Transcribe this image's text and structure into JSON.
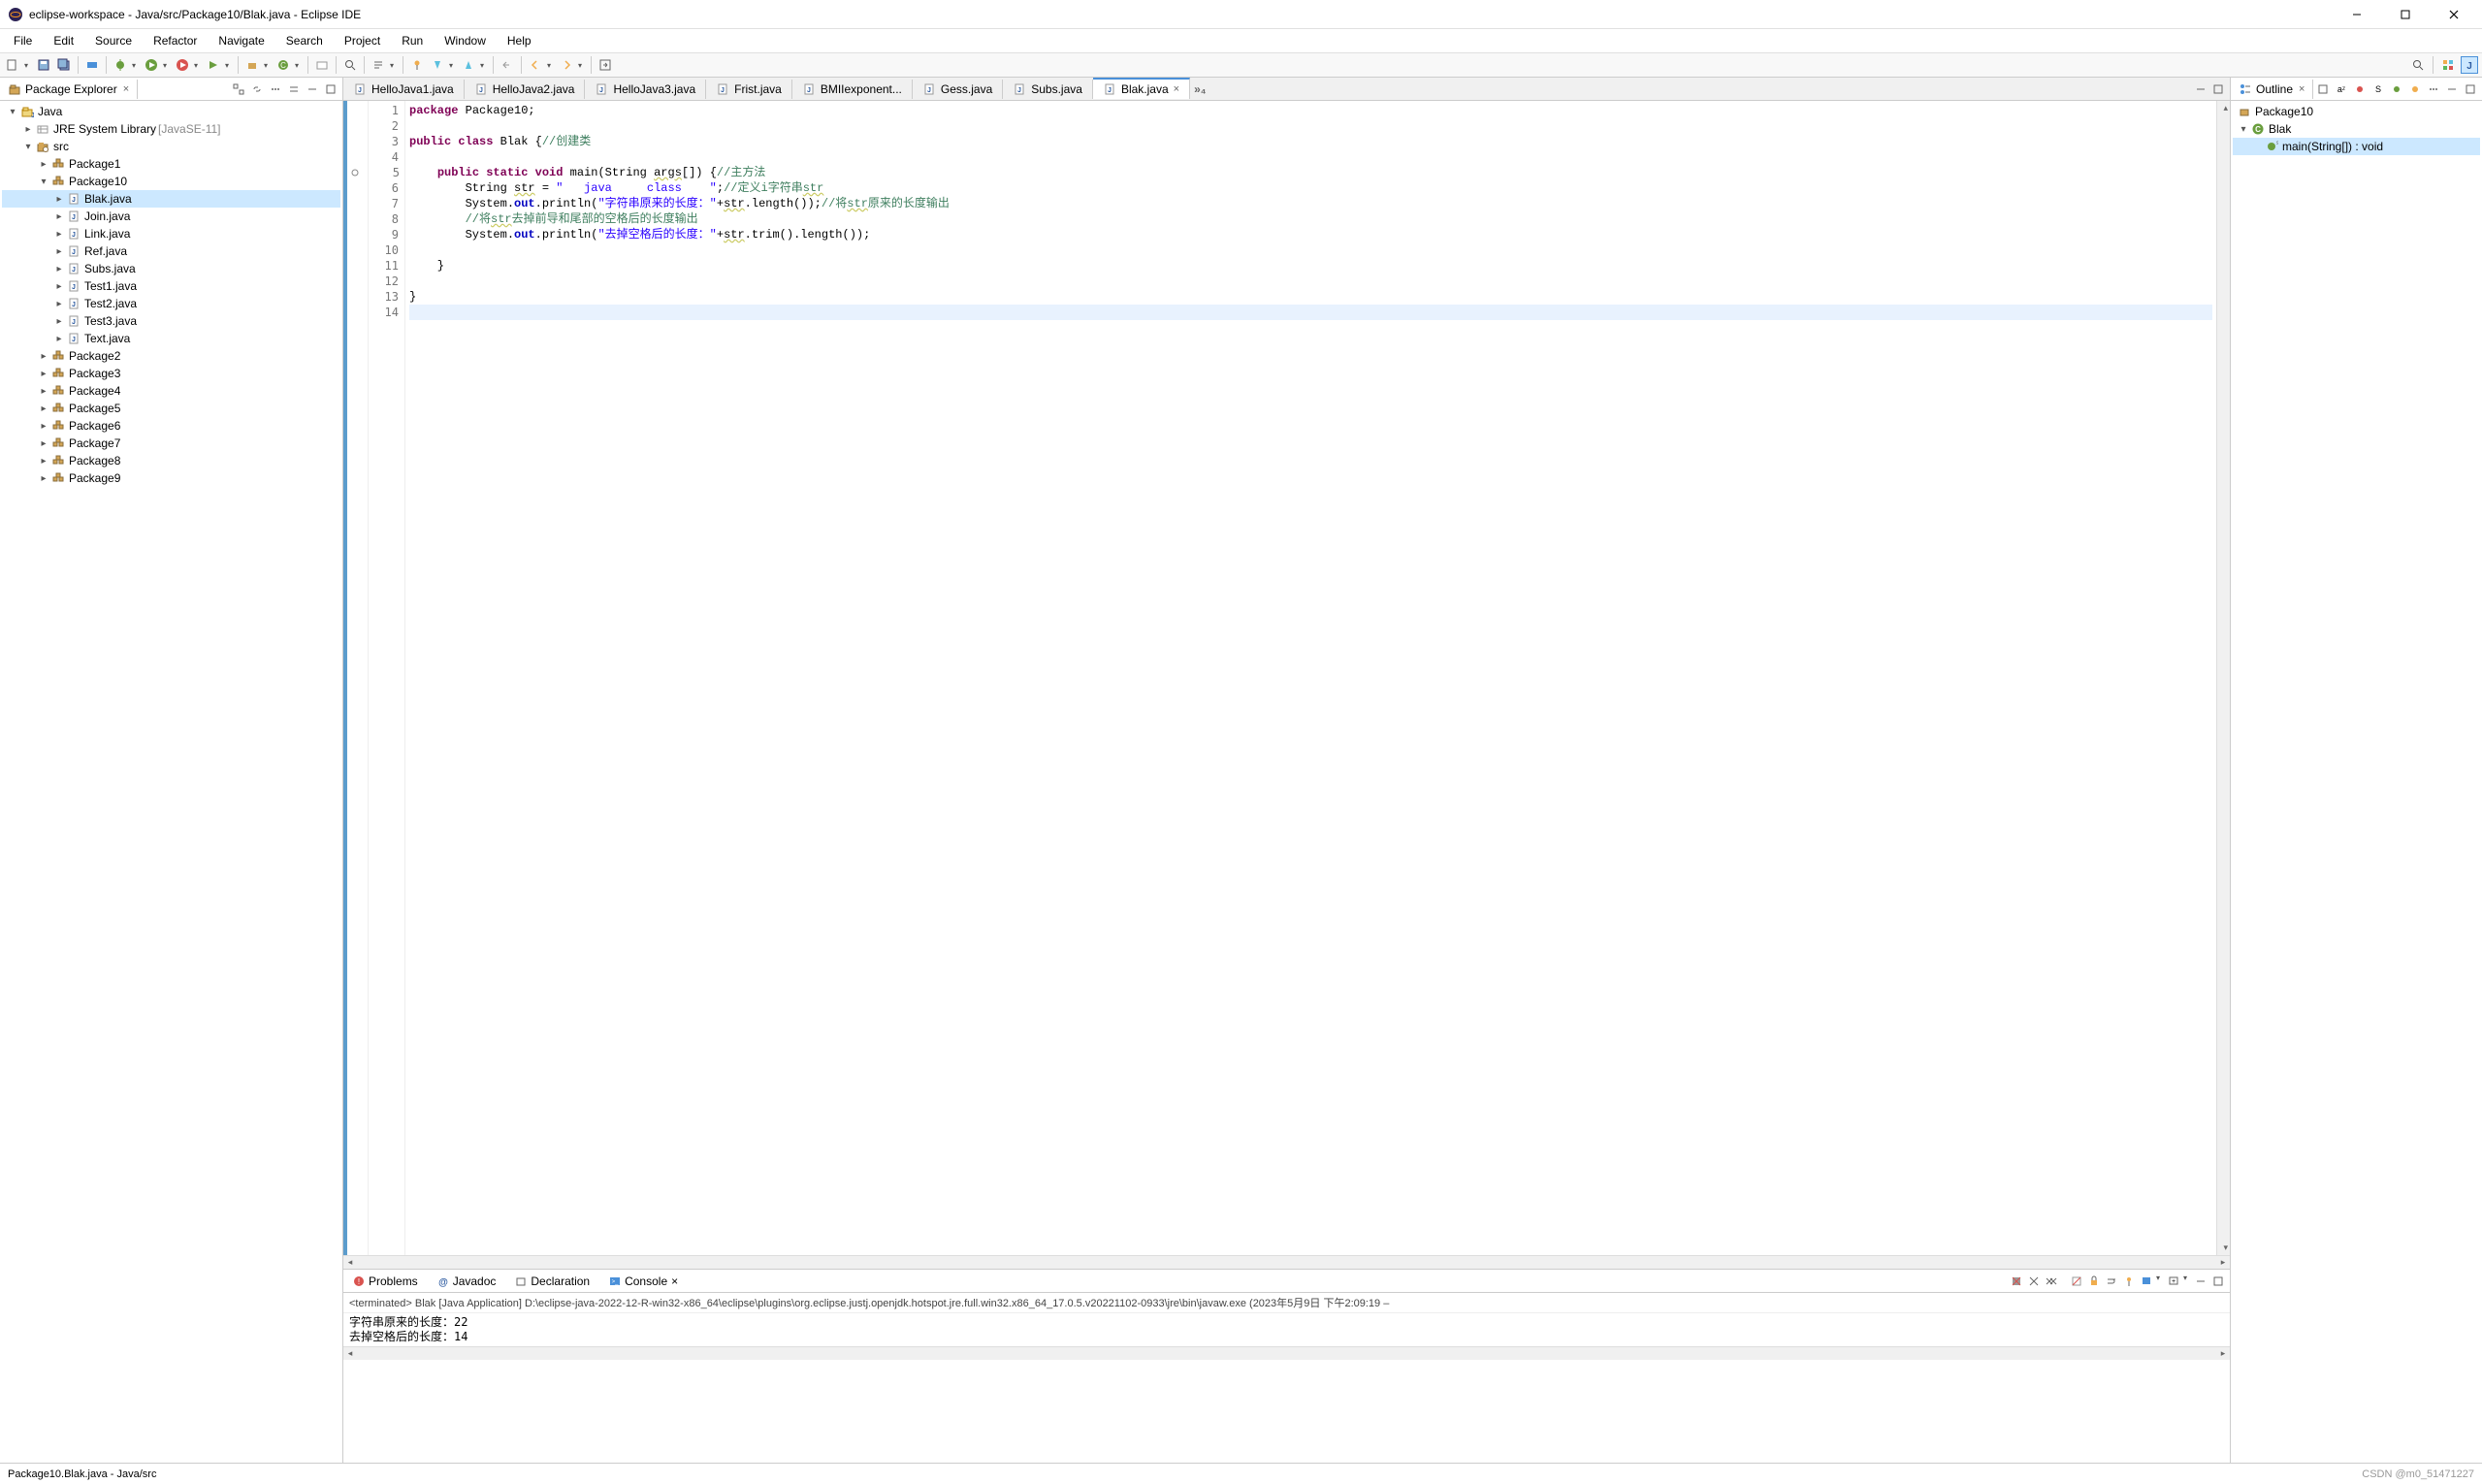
{
  "titlebar": {
    "title": "eclipse-workspace - Java/src/Package10/Blak.java - Eclipse IDE"
  },
  "menu": [
    "File",
    "Edit",
    "Source",
    "Refactor",
    "Navigate",
    "Search",
    "Project",
    "Run",
    "Window",
    "Help"
  ],
  "package_explorer": {
    "title": "Package Explorer",
    "root": "Java",
    "jre": "JRE System Library",
    "jre_decor": "[JavaSE-11]",
    "src": "src",
    "packages_before": [
      "Package1"
    ],
    "open_package": "Package10",
    "open_files": [
      "Blak.java",
      "Join.java",
      "Link.java",
      "Ref.java",
      "Subs.java",
      "Test1.java",
      "Test2.java",
      "Test3.java",
      "Text.java"
    ],
    "packages_after": [
      "Package2",
      "Package3",
      "Package4",
      "Package5",
      "Package6",
      "Package7",
      "Package8",
      "Package9"
    ],
    "selected_file": "Blak.java"
  },
  "editor_tabs": {
    "tabs": [
      "HelloJava1.java",
      "HelloJava2.java",
      "HelloJava3.java",
      "Frist.java",
      "BMIIexponent...",
      "Gess.java",
      "Subs.java",
      "Blak.java"
    ],
    "active": "Blak.java",
    "overflow": "»₄"
  },
  "code": {
    "lines": [
      {
        "num": "1",
        "html": "<span class='kw'>package</span> Package10;"
      },
      {
        "num": "2",
        "html": ""
      },
      {
        "num": "3",
        "html": "<span class='kw'>public</span> <span class='kw'>class</span> Blak {<span class='cmt'>//创建类</span>"
      },
      {
        "num": "4",
        "html": ""
      },
      {
        "num": "5",
        "html": "    <span class='kw'>public</span> <span class='kw'>static</span> <span class='kw'>void</span> main(String <span class='warn'>args</span>[]) {<span class='cmt'>//主方法</span>",
        "marker": "dot"
      },
      {
        "num": "6",
        "html": "        String <span class='warn'>str</span> = <span class='str'>\"   java     class    \"</span>;<span class='cmt'>//定义i字符串<span class='warn'>str</span></span>"
      },
      {
        "num": "7",
        "html": "        System.<span class='field'>out</span>.println(<span class='str'>\"字符串原来的长度：\"</span>+<span class='warn'>str</span>.length());<span class='cmt'>//将<span class='warn'>str</span>原来的长度输出</span>"
      },
      {
        "num": "8",
        "html": "        <span class='cmt'>//将<span class='warn'>str</span>去掉前导和尾部的空格后的长度输出</span>"
      },
      {
        "num": "9",
        "html": "        System.<span class='field'>out</span>.println(<span class='str'>\"去掉空格后的长度：\"</span>+<span class='warn'>str</span>.trim().length());"
      },
      {
        "num": "10",
        "html": ""
      },
      {
        "num": "11",
        "html": "    }"
      },
      {
        "num": "12",
        "html": ""
      },
      {
        "num": "13",
        "html": "}"
      },
      {
        "num": "14",
        "html": "",
        "highlight": true
      }
    ]
  },
  "outline": {
    "title": "Outline",
    "package": "Package10",
    "class": "Blak",
    "method": "main(String[]) : void"
  },
  "bottom": {
    "tabs": [
      "Problems",
      "Javadoc",
      "Declaration",
      "Console"
    ],
    "active": "Console",
    "console_header": "<terminated> Blak [Java Application] D:\\eclipse-java-2022-12-R-win32-x86_64\\eclipse\\plugins\\org.eclipse.justj.openjdk.hotspot.jre.full.win32.x86_64_17.0.5.v20221102-0933\\jre\\bin\\javaw.exe  (2023年5月9日 下午2:09:19 – ",
    "console_lines": [
      "字符串原来的长度：22",
      "去掉空格后的长度：14"
    ]
  },
  "statusbar": {
    "path": "Package10.Blak.java - Java/src",
    "watermark": "CSDN @m0_51471227"
  }
}
